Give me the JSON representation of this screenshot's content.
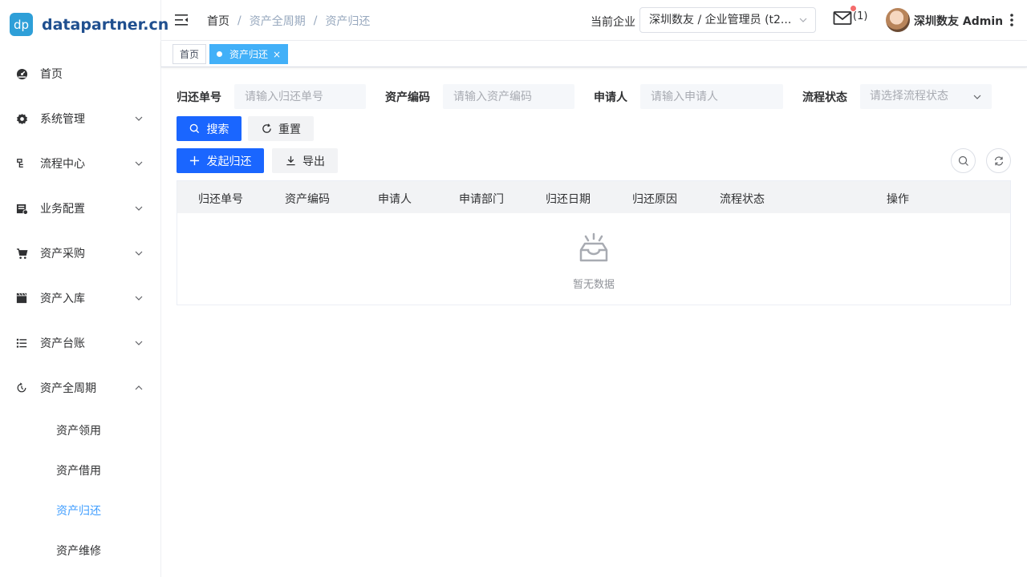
{
  "app": {
    "logo_badge": "dp",
    "logo_text": "datapartner.cn"
  },
  "sidebar": {
    "items": [
      {
        "label": "首页",
        "icon": "dashboard-icon"
      },
      {
        "label": "系统管理",
        "icon": "gear-icon"
      },
      {
        "label": "流程中心",
        "icon": "flow-icon"
      },
      {
        "label": "业务配置",
        "icon": "config-icon"
      },
      {
        "label": "资产采购",
        "icon": "cart-icon"
      },
      {
        "label": "资产入库",
        "icon": "clapper-icon"
      },
      {
        "label": "资产台账",
        "icon": "list-icon"
      },
      {
        "label": "资产全周期",
        "icon": "lifecycle-icon"
      }
    ],
    "sub_items": [
      {
        "label": "资产领用"
      },
      {
        "label": "资产借用"
      },
      {
        "label": "资产归还"
      },
      {
        "label": "资产维修"
      }
    ]
  },
  "header": {
    "breadcrumb": [
      "首页",
      "资产全周期",
      "资产归还"
    ],
    "breadcrumb_sep": "/",
    "company_label": "当前企业",
    "company_value": "深圳数友 / 企业管理员 (t2...",
    "mail_count": "(1)",
    "user_name": "深圳数友 Admin"
  },
  "tags": [
    {
      "label": "首页"
    },
    {
      "label": "资产归还",
      "close": "×"
    }
  ],
  "filters": {
    "return_no": {
      "label": "归还单号",
      "placeholder": "请输入归还单号"
    },
    "asset_code": {
      "label": "资产编码",
      "placeholder": "请输入资产编码"
    },
    "applicant": {
      "label": "申请人",
      "placeholder": "请输入申请人"
    },
    "status": {
      "label": "流程状态",
      "placeholder": "请选择流程状态"
    }
  },
  "buttons": {
    "search": "搜索",
    "reset": "重置",
    "create": "发起归还",
    "export": "导出"
  },
  "table": {
    "columns": [
      "归还单号",
      "资产编码",
      "申请人",
      "申请部门",
      "归还日期",
      "归还原因",
      "流程状态",
      "操作"
    ],
    "rows": [],
    "empty_text": "暂无数据"
  },
  "colors": {
    "primary": "#1a66ff",
    "active_tag": "#42b0f8",
    "active_menu": "#409eff"
  }
}
